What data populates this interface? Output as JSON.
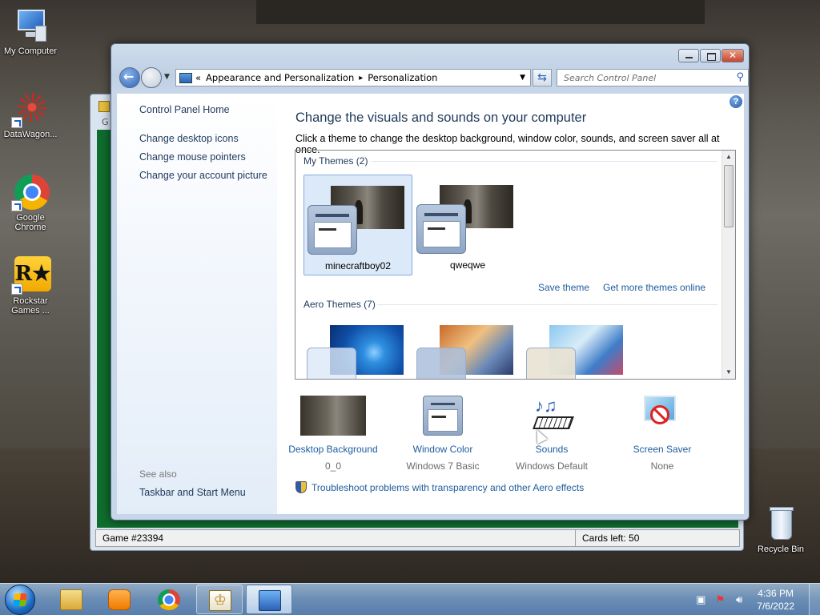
{
  "desktop": {
    "icons": [
      {
        "label": "My Computer"
      },
      {
        "label": "DataWagon..."
      },
      {
        "label": "Google Chrome"
      },
      {
        "label": "Rockstar Games ..."
      },
      {
        "label": "Recycle Bin"
      }
    ]
  },
  "solitaire": {
    "status_game": "Game #23394",
    "status_cards": "Cards left: 50",
    "menu_peek": "G"
  },
  "window": {
    "address": {
      "prefix": "«",
      "crumb1": "Appearance and Personalization",
      "sep": "▸",
      "crumb2": "Personalization"
    },
    "search_placeholder": "Search Control Panel"
  },
  "sidebar": {
    "home": "Control Panel Home",
    "links": [
      "Change desktop icons",
      "Change mouse pointers",
      "Change your account picture"
    ],
    "see_also": "See also",
    "see_also_link": "Taskbar and Start Menu"
  },
  "main": {
    "heading": "Change the visuals and sounds on your computer",
    "subheading": "Click a theme to change the desktop background, window color, sounds, and screen saver all at once.",
    "my_themes_label": "My Themes (2)",
    "my_themes": [
      {
        "name": "minecraftboy02",
        "selected": true
      },
      {
        "name": "qweqwe",
        "selected": false
      }
    ],
    "save_theme": "Save theme",
    "get_more": "Get more themes online",
    "aero_label": "Aero Themes (7)",
    "settings": [
      {
        "label": "Desktop Background",
        "value": "0_0"
      },
      {
        "label": "Window Color",
        "value": "Windows 7 Basic"
      },
      {
        "label": "Sounds",
        "value": "Windows Default"
      },
      {
        "label": "Screen Saver",
        "value": "None"
      }
    ],
    "troubleshoot": "Troubleshoot problems with transparency and other Aero effects"
  },
  "taskbar": {
    "time": "4:36 PM",
    "date": "7/6/2022"
  },
  "colors": {
    "link": "#1e5b9e",
    "heading": "#1e395b",
    "felt": "#0f6d2e"
  }
}
